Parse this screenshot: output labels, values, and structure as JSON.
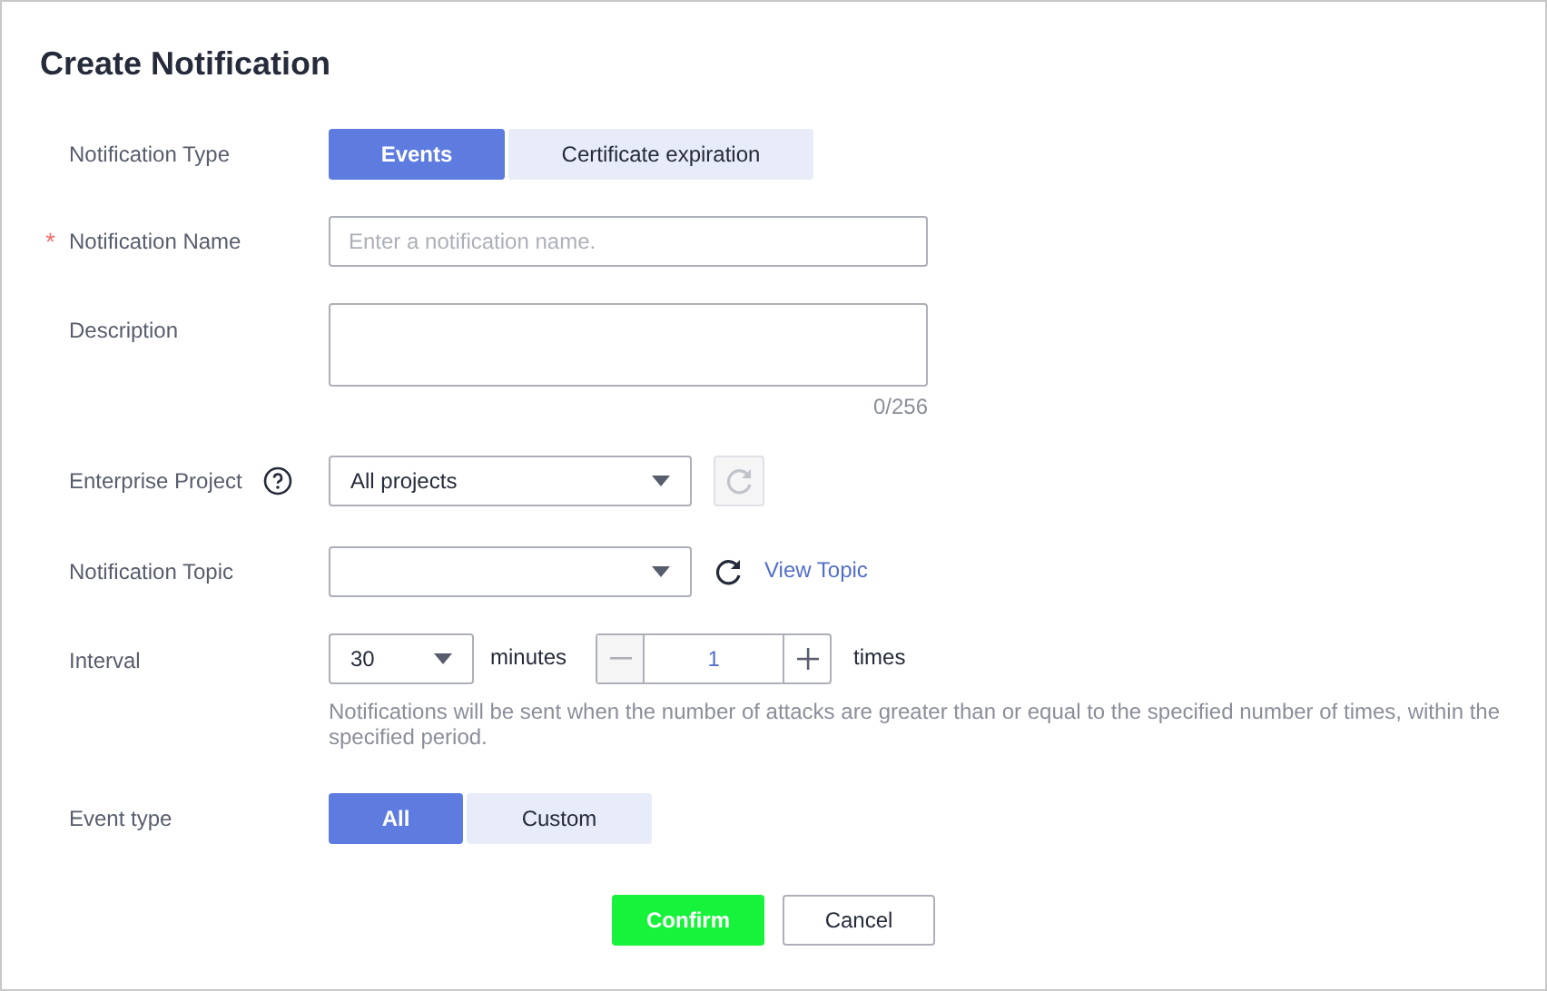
{
  "title": "Create Notification",
  "notification_type": {
    "label": "Notification Type",
    "options": [
      {
        "label": "Events",
        "selected": true
      },
      {
        "label": "Certificate expiration",
        "selected": false
      }
    ]
  },
  "notification_name": {
    "label": "Notification Name",
    "required_mark": "*",
    "placeholder": "Enter a notification name."
  },
  "description": {
    "label": "Description",
    "counter": "0/256"
  },
  "enterprise_project": {
    "label": "Enterprise Project",
    "value": "All projects",
    "refresh_disabled": true
  },
  "notification_topic": {
    "label": "Notification Topic",
    "refresh_disabled": false,
    "link": "View Topic"
  },
  "interval": {
    "label": "Interval",
    "value": "30",
    "unit": "minutes",
    "count": "1",
    "count_unit": "times",
    "hint": "Notifications will be sent when the number of attacks are greater than or equal to the specified number of times, within the specified period."
  },
  "event_type": {
    "label": "Event type",
    "options": [
      {
        "label": "All",
        "selected": true
      },
      {
        "label": "Custom",
        "selected": false
      }
    ]
  },
  "buttons": [
    {
      "label": "Confirm",
      "kind": "primary"
    },
    {
      "label": "Cancel",
      "kind": "secondary"
    }
  ]
}
